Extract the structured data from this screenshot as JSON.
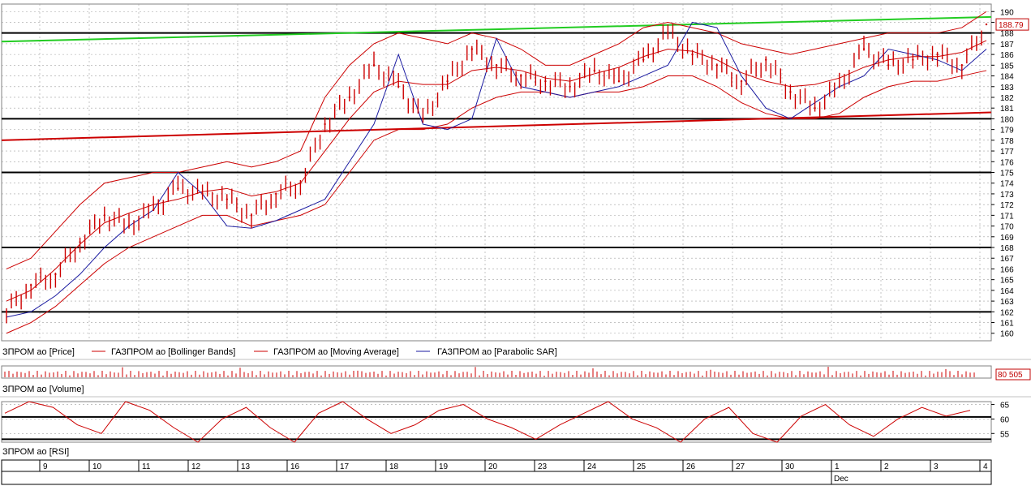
{
  "colors": {
    "background": "#ffffff",
    "candle": "#cc0000",
    "bollinger": "#cc0000",
    "moving_average": "#cc0000",
    "sar": "#1a1aa0",
    "trend_upper": "#22cc22",
    "trend_lower": "#cc0000",
    "level": "#000000",
    "grid": "#a0a0a0"
  },
  "legend": {
    "price": "ЗПРОМ ао [Price]",
    "bollinger": "ГАЗПРОМ ао [Bollinger Bands]",
    "ma": "ГАЗПРОМ ао [Moving Average]",
    "sar": "ГАЗПРОМ ао [Parabolic SAR]"
  },
  "panels": {
    "volume_label": "ЗПРОМ ао [Volume]",
    "rsi_label": "ЗПРОМ ао [RSI]",
    "last_price": "188.79",
    "last_volume": "80 505"
  },
  "time_axis": {
    "days": [
      "9",
      "10",
      "11",
      "12",
      "13",
      "16",
      "17",
      "18",
      "19",
      "20",
      "23",
      "24",
      "25",
      "26",
      "27",
      "30",
      "1",
      "2",
      "3",
      "4"
    ],
    "month_label": "Dec"
  },
  "chart_data": [
    {
      "type": "line",
      "title": "",
      "ylim": [
        159.3,
        190.7
      ],
      "yticks": [
        160,
        161,
        162,
        163,
        164,
        165,
        166,
        167,
        168,
        169,
        170,
        171,
        172,
        173,
        174,
        175,
        176,
        177,
        178,
        179,
        180,
        181,
        182,
        183,
        184,
        185,
        186,
        187,
        188,
        189,
        190
      ],
      "horizontal_levels": [
        162,
        168,
        175,
        180,
        188
      ],
      "trendlines": [
        {
          "name": "upper",
          "from": [
            0,
            187.2
          ],
          "to": [
            1220,
            189.5
          ]
        },
        {
          "name": "lower",
          "from": [
            0,
            178.0
          ],
          "to": [
            1220,
            180.6
          ]
        }
      ],
      "x_index": [
        0,
        1,
        2,
        3,
        4,
        5,
        6,
        7,
        8,
        9,
        10,
        11,
        12,
        13,
        14,
        15,
        16,
        17,
        18,
        19,
        20,
        21,
        22,
        23,
        24,
        25,
        26,
        27,
        28,
        29,
        30,
        31,
        32,
        33,
        34,
        35,
        36,
        37,
        38,
        39,
        40
      ],
      "close": [
        162.0,
        164.5,
        165.5,
        168.5,
        171.0,
        170.0,
        171.5,
        173.5,
        173.0,
        172.5,
        171.0,
        173.0,
        174.0,
        179.5,
        182.0,
        185.0,
        183.0,
        180.0,
        183.5,
        186.5,
        185.0,
        184.0,
        183.5,
        183.0,
        184.5,
        183.5,
        185.5,
        188.0,
        186.0,
        185.0,
        183.5,
        185.5,
        182.5,
        181.0,
        183.0,
        186.5,
        185.0,
        185.5,
        186.0,
        185.0,
        188.8
      ],
      "series": [
        {
          "name": "ГАЗПРОМ ао [Bollinger Bands]",
          "upper": [
            166.0,
            167.0,
            169.5,
            172.0,
            174.0,
            174.5,
            175.0,
            175.0,
            175.5,
            176.0,
            175.5,
            176.0,
            177.0,
            182.0,
            185.0,
            187.0,
            188.0,
            187.5,
            187.0,
            188.0,
            187.5,
            186.5,
            185.0,
            185.0,
            186.0,
            187.0,
            188.5,
            189.0,
            188.5,
            188.0,
            187.0,
            186.5,
            186.0,
            186.5,
            187.0,
            187.5,
            188.0,
            188.0,
            188.0,
            188.5,
            190.0
          ],
          "lower": [
            160.0,
            161.0,
            162.5,
            164.5,
            166.5,
            168.0,
            169.0,
            170.0,
            171.0,
            171.0,
            170.0,
            170.5,
            171.0,
            172.0,
            175.0,
            178.0,
            179.0,
            179.0,
            179.5,
            181.0,
            182.0,
            182.5,
            182.5,
            182.0,
            182.5,
            182.5,
            183.0,
            184.0,
            184.0,
            183.0,
            181.5,
            180.5,
            180.0,
            180.0,
            180.5,
            182.0,
            183.0,
            183.5,
            183.5,
            184.0,
            184.5
          ]
        },
        {
          "name": "ГАЗПРОМ ао [Moving Average]",
          "values": [
            163.0,
            164.0,
            166.0,
            168.3,
            170.3,
            171.2,
            172.0,
            172.5,
            173.2,
            173.5,
            172.8,
            173.2,
            174.0,
            177.0,
            180.0,
            182.5,
            183.5,
            183.2,
            183.2,
            184.5,
            184.8,
            184.5,
            183.8,
            183.5,
            184.2,
            184.8,
            185.8,
            186.5,
            186.3,
            185.5,
            184.3,
            183.5,
            183.0,
            183.2,
            183.8,
            184.8,
            185.5,
            185.8,
            185.8,
            186.2,
            187.3
          ]
        },
        {
          "name": "ГАЗПРОМ ао [Parabolic SAR]",
          "values": [
            161.5,
            162.0,
            163.5,
            165.5,
            168.0,
            170.0,
            171.5,
            175.0,
            173.0,
            170.0,
            169.8,
            170.5,
            171.5,
            172.5,
            176.0,
            179.5,
            186.0,
            179.5,
            179.0,
            180.0,
            187.5,
            183.0,
            182.5,
            182.0,
            182.5,
            183.0,
            184.0,
            185.0,
            189.0,
            188.5,
            184.0,
            181.0,
            180.0,
            181.5,
            183.0,
            184.0,
            186.5,
            186.0,
            185.5,
            184.5,
            186.5
          ]
        }
      ]
    },
    {
      "type": "bar",
      "title": "ЗПРОМ ао [Volume]",
      "last_value": "80 505"
    },
    {
      "type": "line",
      "title": "ЗПРОМ ао [RSI]",
      "ylim": [
        52,
        66
      ],
      "yticks": [
        55,
        60,
        65
      ],
      "horizontal_levels": [
        53,
        60.7
      ],
      "values": [
        62,
        66,
        64,
        58,
        55,
        66,
        63,
        57,
        52,
        60,
        64,
        57,
        52,
        62,
        66,
        60,
        55,
        58,
        63,
        65,
        60,
        57,
        53,
        58,
        62,
        66,
        60,
        57,
        52,
        60,
        64,
        55,
        52,
        61,
        65,
        58,
        54,
        60,
        64,
        61,
        63
      ]
    }
  ]
}
